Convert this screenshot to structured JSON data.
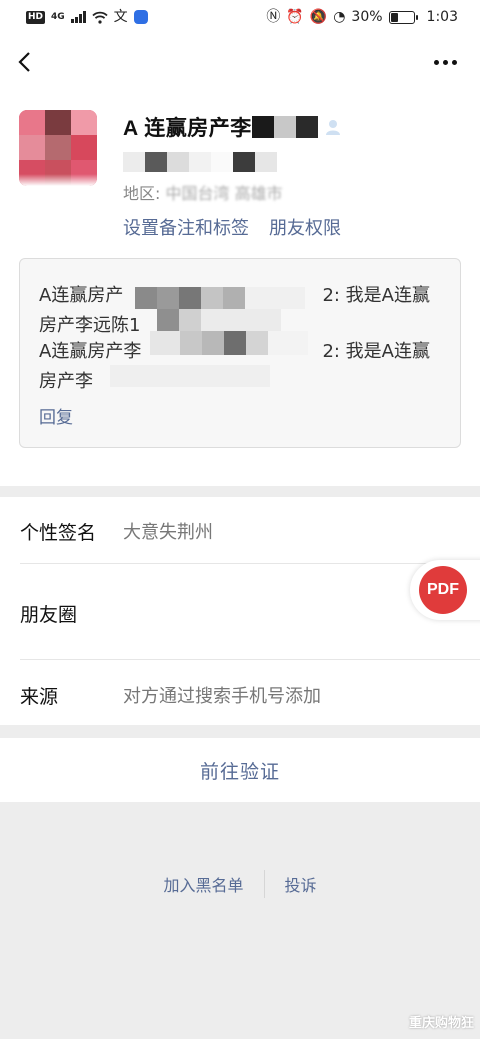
{
  "status_bar": {
    "hd": "HD",
    "network": "4G",
    "battery": "30%",
    "time": "1:03"
  },
  "contact": {
    "name": "A 连赢房产李",
    "region_label": "地区:",
    "region_value": "中国台湾 高雄市"
  },
  "actions": {
    "set_remark": "设置备注和标签",
    "friend_permission": "朋友权限"
  },
  "moments_preview": {
    "line1_left": "A连赢房产",
    "line1_right": "2: 我是A连赢",
    "line2_left": "房产李远陈1",
    "line3_left": "A连赢房产李",
    "line3_right": "2: 我是A连赢",
    "line4_left": "房产李",
    "reply": "回复"
  },
  "info": {
    "signature_label": "个性签名",
    "signature_value": "大意失荆州",
    "moments_label": "朋友圈",
    "source_label": "来源",
    "source_value": "对方通过搜索手机号添加"
  },
  "pdf_button": "PDF",
  "verify_button": "前往验证",
  "bottom": {
    "blacklist": "加入黑名单",
    "report": "投诉"
  },
  "watermark": "重庆购物狂",
  "colors": {
    "link": "#576b95",
    "pdf": "#e03b3b",
    "background": "#ededed"
  }
}
